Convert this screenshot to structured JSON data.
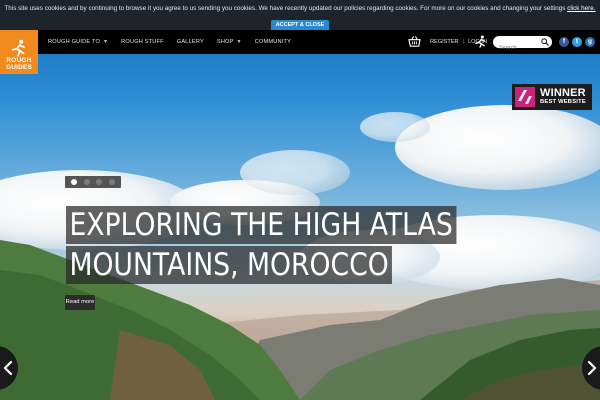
{
  "cookie_bar": {
    "message": "This site uses cookies and by continuing to browse it you agree to us sending you cookies. We have recently updated our policies regarding cookies. For more on our cookies and changing your settings",
    "link_label": "click here.",
    "button_label": "ACCEPT & CLOSE"
  },
  "brand": {
    "logo_line1": "ROUGH",
    "logo_line2": "GUIDES",
    "color": "#f08a1c"
  },
  "nav": {
    "items": [
      {
        "label": "ROUGH GUIDE TO",
        "has_dropdown": true
      },
      {
        "label": "ROUGH STUFF",
        "has_dropdown": false
      },
      {
        "label": "GALLERY",
        "has_dropdown": false
      },
      {
        "label": "SHOP",
        "has_dropdown": true
      },
      {
        "label": "COMMUNITY",
        "has_dropdown": false
      }
    ],
    "register_label": "REGISTER",
    "separator": "|",
    "login_label": "LOG IN",
    "search_placeholder": "Search",
    "social": [
      {
        "icon": "facebook-icon",
        "glyph": "f",
        "color": "#3b5998"
      },
      {
        "icon": "twitter-icon",
        "glyph": "t",
        "color": "#2fa3e0"
      },
      {
        "icon": "google-plus-icon",
        "glyph": "g",
        "color": "#2a6fb0"
      }
    ]
  },
  "award": {
    "title": "WINNER",
    "subtitle": "BEST WEBSITE",
    "accent": "#c9247a"
  },
  "slider": {
    "slide_count": 4,
    "active_index": 0
  },
  "hero": {
    "headline_line1": "EXPLORING THE HIGH ATLAS",
    "headline_line2": "MOUNTAINS, MOROCCO",
    "read_more_label": "Read more"
  }
}
